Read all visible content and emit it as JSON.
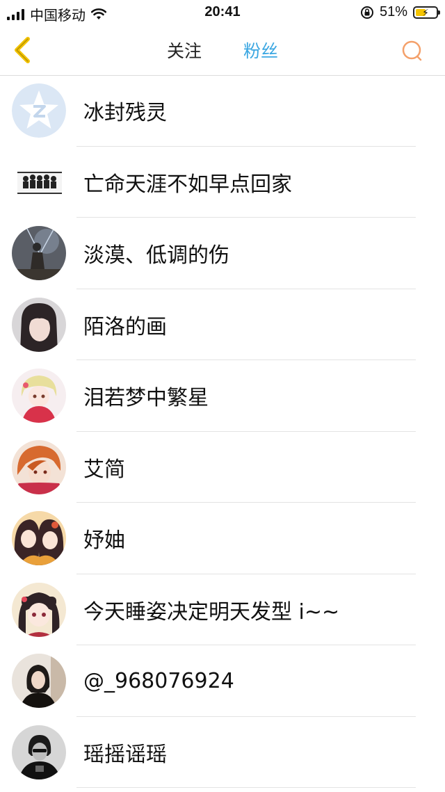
{
  "status_bar": {
    "carrier": "中国移动",
    "time": "20:41",
    "battery_percent": "51%",
    "battery_level": 0.51,
    "battery_color": "#f5c400"
  },
  "nav": {
    "back_icon": "chevron-left-icon",
    "back_color": "#f2c200",
    "tabs": [
      {
        "label": "关注",
        "active": false
      },
      {
        "label": "粉丝",
        "active": true
      }
    ],
    "active_color": "#3ba7e2",
    "search_icon": "search-icon",
    "search_color": "#f4a06a"
  },
  "followers": [
    {
      "name": "冰封残灵",
      "avatar": "default-qq-avatar"
    },
    {
      "name": "亡命天涯不如早点回家",
      "avatar": "group-photo-avatar"
    },
    {
      "name": "淡漠、低调的伤",
      "avatar": "warrior-avatar"
    },
    {
      "name": "陌洛的画",
      "avatar": "girl-photo-avatar"
    },
    {
      "name": "泪若梦中繁星",
      "avatar": "anime-girl-avatar"
    },
    {
      "name": "艾简",
      "avatar": "anime-boy-avatar"
    },
    {
      "name": "妤妯",
      "avatar": "anime-twins-avatar"
    },
    {
      "name": "今天睡姿决定明天发型 i~~",
      "avatar": "anime-doll-avatar"
    },
    {
      "name": "@_968076924",
      "avatar": "woman-photo-avatar"
    },
    {
      "name": "瑶摇谣瑶",
      "avatar": "bw-person-avatar"
    }
  ]
}
